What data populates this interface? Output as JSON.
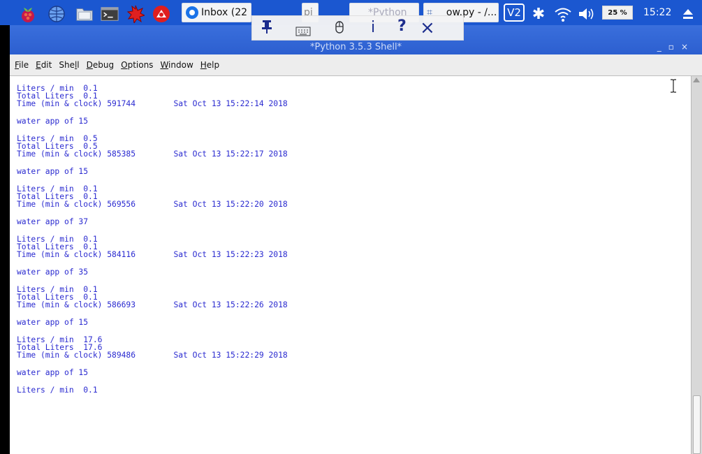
{
  "taskbar": {
    "apps": [
      {
        "name": "raspberry-menu-icon"
      },
      {
        "name": "web-browser-icon"
      },
      {
        "name": "file-manager-icon"
      },
      {
        "name": "terminal-icon"
      },
      {
        "name": "burst-icon"
      },
      {
        "name": "vnc-icon"
      }
    ],
    "tasks": [
      {
        "label": "Inbox (22",
        "icon": "chrome-icon"
      },
      {
        "label": "pi",
        "icon": "pin-icon"
      },
      {
        "label": "*Python",
        "icon": "python-icon"
      },
      {
        "label": "ow.py - /...",
        "icon": "python-icon"
      }
    ],
    "tray": {
      "vnc_label": "V2",
      "cpu_percent": "25 %",
      "clock": "15:22"
    }
  },
  "floating_toolbar": {
    "items": [
      "pin-icon",
      "keyboard-icon",
      "mouse-icon",
      "info-icon",
      "help-icon",
      "close-icon"
    ]
  },
  "window": {
    "title": "*Python 3.5.3 Shell*",
    "controls": [
      "_",
      "▫",
      "×"
    ]
  },
  "menubar": {
    "items": [
      {
        "mnemonic": "F",
        "rest": "ile"
      },
      {
        "mnemonic": "E",
        "rest": "dit"
      },
      {
        "mnemonic": "",
        "rest": "She",
        "mnemonic2": "l",
        "rest2": "l"
      },
      {
        "mnemonic": "D",
        "rest": "ebug"
      },
      {
        "mnemonic": "O",
        "rest": "ptions"
      },
      {
        "mnemonic": "W",
        "rest": "indow"
      },
      {
        "mnemonic": "H",
        "rest": "elp"
      }
    ]
  },
  "shell": {
    "lines": [
      "Liters / min  0.1",
      "Total Liters  0.1",
      "Time (min & clock) 591744        Sat Oct 13 15:22:14 2018",
      "",
      "water app of 15",
      "",
      "Liters / min  0.5",
      "Total Liters  0.5",
      "Time (min & clock) 585385        Sat Oct 13 15:22:17 2018",
      "",
      "water app of 15",
      "",
      "Liters / min  0.1",
      "Total Liters  0.1",
      "Time (min & clock) 569556        Sat Oct 13 15:22:20 2018",
      "",
      "water app of 37",
      "",
      "Liters / min  0.1",
      "Total Liters  0.1",
      "Time (min & clock) 584116        Sat Oct 13 15:22:23 2018",
      "",
      "water app of 35",
      "",
      "Liters / min  0.1",
      "Total Liters  0.1",
      "Time (min & clock) 586693        Sat Oct 13 15:22:26 2018",
      "",
      "water app of 15",
      "",
      "Liters / min  17.6",
      "Total Liters  17.6",
      "Time (min & clock) 589486        Sat Oct 13 15:22:29 2018",
      "",
      "water app of 15",
      "",
      "Liters / min  0.1"
    ]
  },
  "colors": {
    "panel": "#1b57d0",
    "shell_text": "#2a2ad0"
  }
}
